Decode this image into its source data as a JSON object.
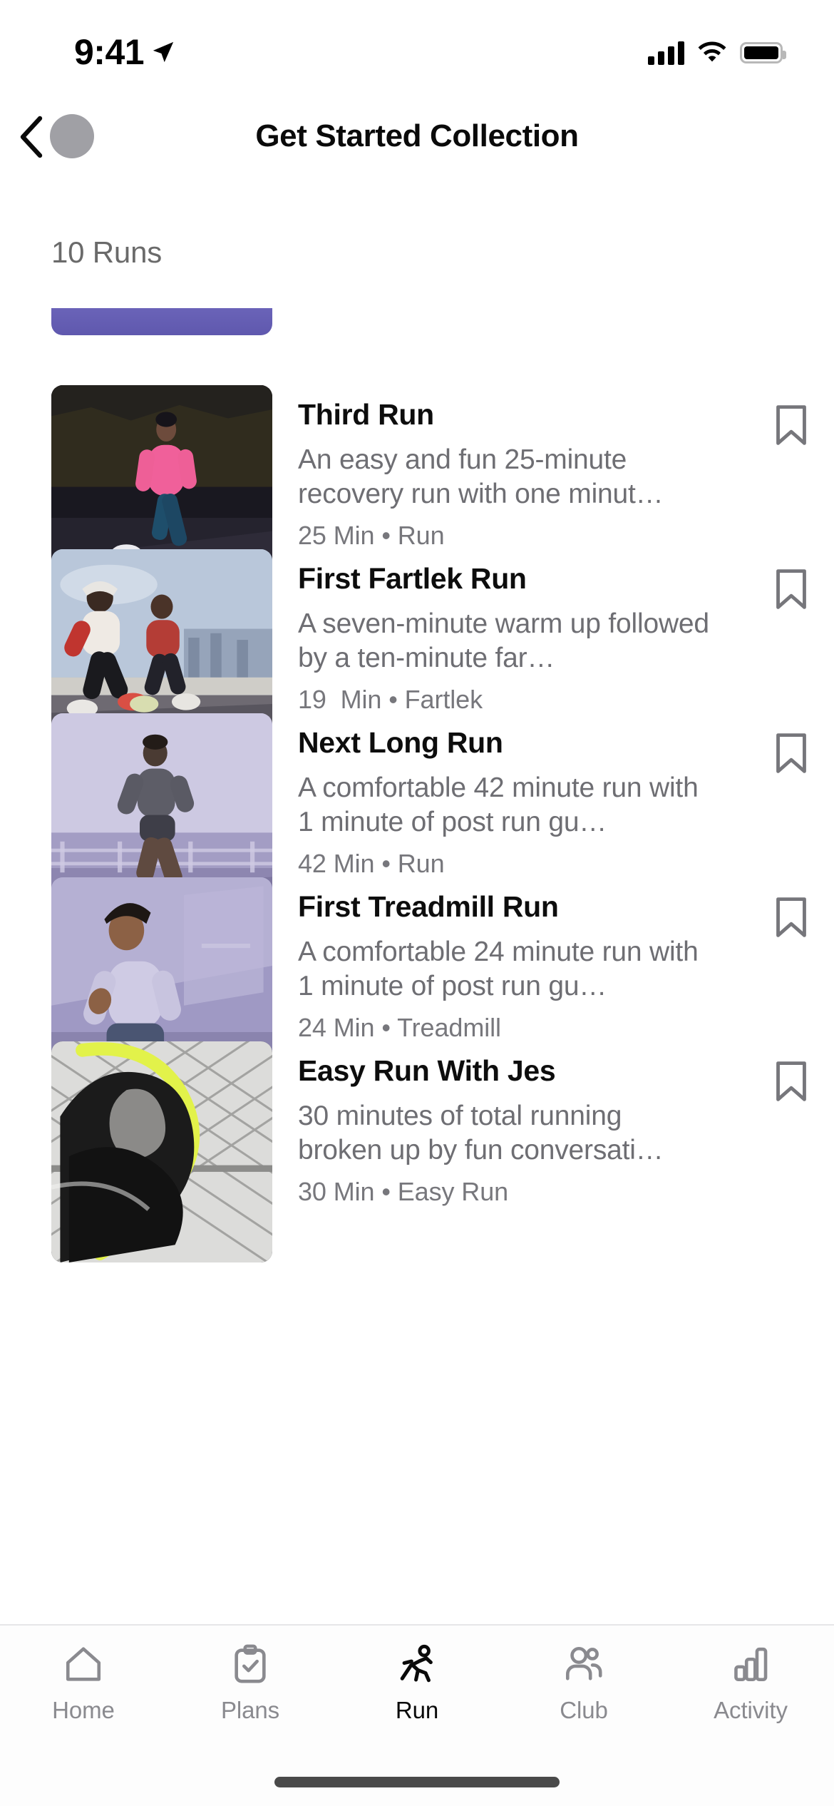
{
  "status_bar": {
    "time": "9:41",
    "location_icon": "location-arrow-icon",
    "cellular_icon": "cellular-signal-icon",
    "wifi_icon": "wifi-icon",
    "battery_icon": "battery-full-icon"
  },
  "nav": {
    "back_icon": "chevron-left-icon",
    "avatar": "profile-avatar",
    "title": "Get Started Collection"
  },
  "section": {
    "count_label": "10 Runs"
  },
  "list": {
    "bookmark_icon": "bookmark-icon",
    "items": [
      {
        "title": "Third Run",
        "description": "An easy and fun 25-minute recovery run with one minut…",
        "meta": "25 Min • Run",
        "thumb": "runner-pink-top-night",
        "thumb_bg": "#1d1c22"
      },
      {
        "title": "First Fartlek Run",
        "description": "A seven-minute warm up followed by a ten-minute far…",
        "meta": "19  Min • Fartlek",
        "thumb": "runners-group-bridge",
        "thumb_bg": "#9aa6bd"
      },
      {
        "title": "Next Long Run",
        "description": "A comfortable 42 minute run with 1 minute of post run gu…",
        "meta": "42 Min • Run",
        "thumb": "runner-grey-top-bridge",
        "thumb_bg": "#b3afd1"
      },
      {
        "title": "First Treadmill Run",
        "description": "A comfortable 24 minute run with 1 minute of post run gu…",
        "meta": "24 Min • Treadmill",
        "thumb": "runner-treadmill-indoor",
        "thumb_bg": "#a7a2c9"
      },
      {
        "title": "Easy Run With Jes",
        "description": "30 minutes of total running broken up by fun conversati…",
        "meta": "30 Min • Easy Run",
        "thumb": "runner-fence-bw-yellow",
        "thumb_bg": "#d8d8d6"
      }
    ]
  },
  "tabbar": {
    "items": [
      {
        "label": "Home",
        "icon": "home-icon",
        "active": false
      },
      {
        "label": "Plans",
        "icon": "clipboard-check-icon",
        "active": false
      },
      {
        "label": "Run",
        "icon": "running-person-icon",
        "active": true
      },
      {
        "label": "Club",
        "icon": "people-icon",
        "active": false
      },
      {
        "label": "Activity",
        "icon": "bar-chart-icon",
        "active": false
      }
    ]
  },
  "colors": {
    "accent_purple": "#645cb4",
    "text_primary": "#0d0d0d",
    "text_secondary": "#6e6e73",
    "tab_inactive": "#8a8a8f"
  }
}
